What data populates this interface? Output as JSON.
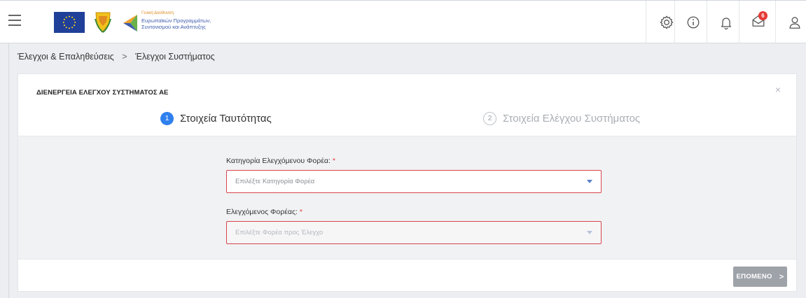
{
  "header": {
    "brand_line1": "Γενική Διεύθυνση",
    "brand_line2": "Ευρωπαϊκών Προγραμμάτων,",
    "brand_line3": "Συντονισμού και Ανάπτυξης",
    "notification_count": "6",
    "icons": [
      "menu-icon",
      "settings-icon",
      "info-icon",
      "bell-icon",
      "messages-icon",
      "user-icon"
    ]
  },
  "breadcrumb": {
    "items": [
      "Έλεγχοι & Επαληθεύσεις",
      "Έλεγχοι Συστήματος"
    ],
    "separator": ">"
  },
  "panel": {
    "title": "ΔΙΕΝΕΡΓΕΙΑ ΕΛΕΓΧΟΥ ΣΥΣΤΗΜΑΤΟΣ ΑΕ",
    "close_label": "×"
  },
  "steps": [
    {
      "number": "1",
      "label": "Στοιχεία Ταυτότητας",
      "active": true
    },
    {
      "number": "2",
      "label": "Στοιχεία Ελέγχου Συστήματος",
      "active": false
    }
  ],
  "form": {
    "category": {
      "label": "Κατηγορία Ελεγχόμενου Φορέα:",
      "required_mark": "*",
      "placeholder": "Επιλέξτε Κατηγορία Φορέα"
    },
    "entity": {
      "label": "Ελεγχόμενος Φορέας:",
      "required_mark": "*",
      "placeholder": "Επιλέξτε Φορέα προς Έλεγχο"
    }
  },
  "footer": {
    "next_label": "ΕΠΟΜΕΝΟ",
    "next_chevron": ">"
  },
  "colors": {
    "accent": "#2f80ed",
    "error_border": "#d7454b",
    "required": "#e53935",
    "badge": "#e53935",
    "button_disabled": "#9ea3a9"
  }
}
